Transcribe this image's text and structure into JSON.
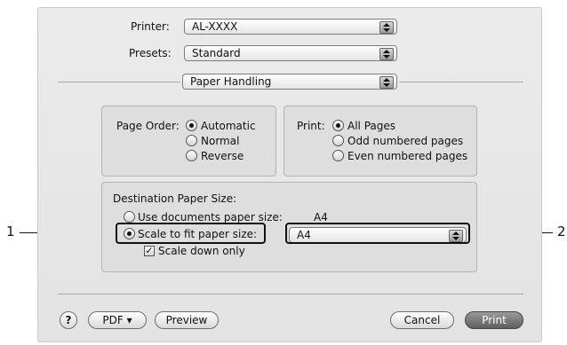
{
  "printer": {
    "label": "Printer:",
    "value": "AL-XXXX"
  },
  "presets": {
    "label": "Presets:",
    "value": "Standard"
  },
  "panel": {
    "value": "Paper Handling"
  },
  "page_order": {
    "label": "Page Order:",
    "options": [
      "Automatic",
      "Normal",
      "Reverse"
    ],
    "selected": "Automatic"
  },
  "print_pages": {
    "label": "Print:",
    "options": [
      "All Pages",
      "Odd numbered pages",
      "Even numbered pages"
    ],
    "selected": "All Pages"
  },
  "destination": {
    "label": "Destination Paper Size:",
    "use_documents_label": "Use documents paper size:",
    "use_documents_value": "A4",
    "scale_to_fit_label": "Scale to fit paper size:",
    "paper_size_value": "A4",
    "scale_down_label": "Scale down only",
    "scale_down_checked": true,
    "selected": "scale_to_fit"
  },
  "footer": {
    "help_label": "?",
    "pdf_label": "PDF ▾",
    "preview_label": "Preview",
    "cancel_label": "Cancel",
    "print_label": "Print"
  },
  "callouts": [
    "1",
    "2"
  ]
}
